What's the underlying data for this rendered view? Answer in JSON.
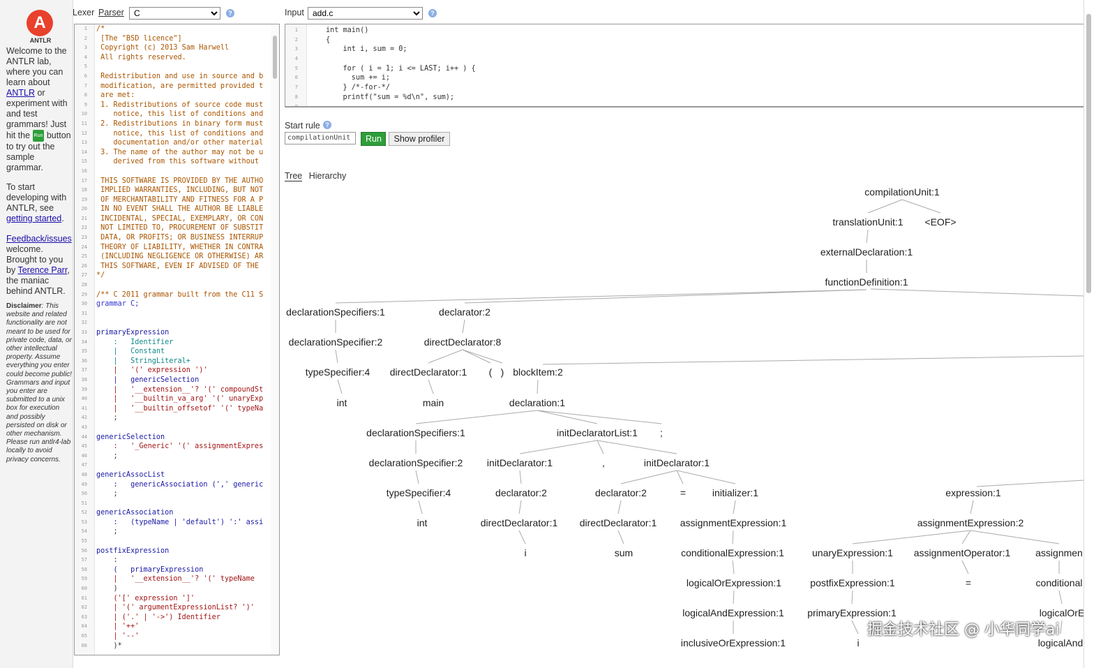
{
  "intro": {
    "logo_text": "ANTLR",
    "p1_a": "Welcome to the ANTLR lab, where you can learn about ",
    "p1_link": "ANTLR",
    "p1_b": " or experiment with and test grammars! Just hit the ",
    "p1_run": "Run",
    "p1_c": " button to try out the sample grammar.",
    "p2_a": "To start developing with ANTLR, see ",
    "p2_link": "getting started",
    "p2_b": ".",
    "p3_link": "Feedback/issues",
    "p3_a": " welcome. Brought to you by ",
    "p3_link2": "Terence Parr",
    "p3_b": ", the maniac behind ANTLR.",
    "disclaimer_label": "Disclaimer",
    "disclaimer_text": ": This website and related functionality are not meant to be used for private code, data, or other intellectual property. Assume everything you enter could become public! Grammars and input you enter are submitted to a unix box for execution and possibly persisted on disk or other mechanism. Please run antlr4-lab locally to avoid privacy concerns."
  },
  "toolbar": {
    "lexer_label": "Lexer",
    "parser_label": "Parser",
    "grammar_select": "C",
    "input_label": "Input",
    "input_select": "add.c",
    "help_glyph": "?"
  },
  "grammar_lines": [
    {
      "n": "1",
      "t": "/*",
      "c": "cm"
    },
    {
      "n": "2",
      "t": " [The \"BSD licence\"]",
      "c": "cm"
    },
    {
      "n": "3",
      "t": " Copyright (c) 2013 Sam Harwell",
      "c": "cm"
    },
    {
      "n": "4",
      "t": " All rights reserved.",
      "c": "cm"
    },
    {
      "n": "5",
      "t": "",
      "c": "cm"
    },
    {
      "n": "6",
      "t": " Redistribution and use in source and b",
      "c": "cm"
    },
    {
      "n": "7",
      "t": " modification, are permitted provided t",
      "c": "cm"
    },
    {
      "n": "8",
      "t": " are met:",
      "c": "cm"
    },
    {
      "n": "9",
      "t": " 1. Redistributions of source code must",
      "c": "cm"
    },
    {
      "n": "10",
      "t": "    notice, this list of conditions and",
      "c": "cm"
    },
    {
      "n": "11",
      "t": " 2. Redistributions in binary form must",
      "c": "cm"
    },
    {
      "n": "12",
      "t": "    notice, this list of conditions and",
      "c": "cm"
    },
    {
      "n": "13",
      "t": "    documentation and/or other material",
      "c": "cm"
    },
    {
      "n": "14",
      "t": " 3. The name of the author may not be u",
      "c": "cm"
    },
    {
      "n": "15",
      "t": "    derived from this software without",
      "c": "cm"
    },
    {
      "n": "16",
      "t": "",
      "c": "cm"
    },
    {
      "n": "17",
      "t": " THIS SOFTWARE IS PROVIDED BY THE AUTHO",
      "c": "cm"
    },
    {
      "n": "18",
      "t": " IMPLIED WARRANTIES, INCLUDING, BUT NOT",
      "c": "cm"
    },
    {
      "n": "19",
      "t": " OF MERCHANTABILITY AND FITNESS FOR A P",
      "c": "cm"
    },
    {
      "n": "20",
      "t": " IN NO EVENT SHALL THE AUTHOR BE LIABLE",
      "c": "cm"
    },
    {
      "n": "21",
      "t": " INCIDENTAL, SPECIAL, EXEMPLARY, OR CON",
      "c": "cm"
    },
    {
      "n": "22",
      "t": " NOT LIMITED TO, PROCUREMENT OF SUBSTIT",
      "c": "cm"
    },
    {
      "n": "23",
      "t": " DATA, OR PROFITS; OR BUSINESS INTERRUP",
      "c": "cm"
    },
    {
      "n": "24",
      "t": " THEORY OF LIABILITY, WHETHER IN CONTRA",
      "c": "cm"
    },
    {
      "n": "25",
      "t": " (INCLUDING NEGLIGENCE OR OTHERWISE) AR",
      "c": "cm"
    },
    {
      "n": "26",
      "t": " THIS SOFTWARE, EVEN IF ADVISED OF THE",
      "c": "cm"
    },
    {
      "n": "27",
      "t": "*/",
      "c": "cm"
    },
    {
      "n": "28",
      "t": "",
      "c": "plain"
    },
    {
      "n": "29",
      "t": "/** C 2011 grammar built from the C11 S",
      "c": "cm"
    },
    {
      "n": "30",
      "t": "grammar C;",
      "c": "kw"
    },
    {
      "n": "31",
      "t": "",
      "c": "plain"
    },
    {
      "n": "32",
      "t": "",
      "c": "plain"
    },
    {
      "n": "33",
      "t": "primaryExpression",
      "c": "rule"
    },
    {
      "n": "34",
      "t": "    :   Identifier",
      "c": "id"
    },
    {
      "n": "35",
      "t": "    |   Constant",
      "c": "id"
    },
    {
      "n": "36",
      "t": "    |   StringLiteral+",
      "c": "id"
    },
    {
      "n": "37",
      "t": "    |   '(' expression ')'",
      "c": "str"
    },
    {
      "n": "38",
      "t": "    |   genericSelection",
      "c": "rule"
    },
    {
      "n": "39",
      "t": "    |   '__extension__'? '(' compoundSt",
      "c": "str"
    },
    {
      "n": "40",
      "t": "    |   '__builtin_va_arg' '(' unaryExp",
      "c": "str"
    },
    {
      "n": "41",
      "t": "    |   '__builtin_offsetof' '(' typeNa",
      "c": "str"
    },
    {
      "n": "42",
      "t": "    ;",
      "c": "plain"
    },
    {
      "n": "43",
      "t": "",
      "c": "plain"
    },
    {
      "n": "44",
      "t": "genericSelection",
      "c": "rule"
    },
    {
      "n": "45",
      "t": "    :   '_Generic' '(' assignmentExpres",
      "c": "str"
    },
    {
      "n": "46",
      "t": "    ;",
      "c": "plain"
    },
    {
      "n": "47",
      "t": "",
      "c": "plain"
    },
    {
      "n": "48",
      "t": "genericAssocList",
      "c": "rule"
    },
    {
      "n": "49",
      "t": "    :   genericAssociation (',' generic",
      "c": "rule"
    },
    {
      "n": "50",
      "t": "    ;",
      "c": "plain"
    },
    {
      "n": "51",
      "t": "",
      "c": "plain"
    },
    {
      "n": "52",
      "t": "genericAssociation",
      "c": "rule"
    },
    {
      "n": "53",
      "t": "    :   (typeName | 'default') ':' assi",
      "c": "rule"
    },
    {
      "n": "54",
      "t": "    ;",
      "c": "plain"
    },
    {
      "n": "55",
      "t": "",
      "c": "plain"
    },
    {
      "n": "56",
      "t": "postfixExpression",
      "c": "rule"
    },
    {
      "n": "57",
      "t": "    :",
      "c": "plain"
    },
    {
      "n": "58",
      "t": "    (   primaryExpression",
      "c": "rule"
    },
    {
      "n": "59",
      "t": "    |   '__extension__'? '(' typeName",
      "c": "str"
    },
    {
      "n": "60",
      "t": "    )",
      "c": "plain"
    },
    {
      "n": "61",
      "t": "    ('[' expression ']'",
      "c": "str"
    },
    {
      "n": "62",
      "t": "    | '(' argumentExpressionList? ')'",
      "c": "str"
    },
    {
      "n": "63",
      "t": "    | ('.' | '->') Identifier",
      "c": "str"
    },
    {
      "n": "64",
      "t": "    | '++'",
      "c": "str"
    },
    {
      "n": "65",
      "t": "    | '--'",
      "c": "str"
    },
    {
      "n": "66",
      "t": "    )*",
      "c": "plain"
    }
  ],
  "input_lines": [
    {
      "n": "1",
      "t": "int main()"
    },
    {
      "n": "2",
      "t": "{"
    },
    {
      "n": "3",
      "t": "    int i, sum = 0;"
    },
    {
      "n": "4",
      "t": ""
    },
    {
      "n": "5",
      "t": "    for ( i = 1; i <= LAST; i++ ) {"
    },
    {
      "n": "6",
      "t": "      sum += i;"
    },
    {
      "n": "7",
      "t": "    } /*-for-*/"
    },
    {
      "n": "8",
      "t": "    printf(\"sum = %d\\n\", sum);"
    },
    {
      "n": "9",
      "t": ""
    }
  ],
  "start_rule": {
    "label": "Start rule",
    "value": "compilationUnit",
    "run_label": "Run",
    "profiler_label": "Show profiler"
  },
  "tabs": {
    "tree": "Tree",
    "hierarchy": "Hierarchy"
  },
  "tree_labels": {
    "compilationUnit": "compilationUnit:1",
    "translationUnit": "translationUnit:1",
    "eof": "<EOF>",
    "externalDeclaration": "externalDeclaration:1",
    "functionDefinition": "functionDefinition:1",
    "declSpecs1": "declarationSpecifiers:1",
    "declarator2a": "declarator:2",
    "declSpec2a": "declarationSpecifier:2",
    "directDecl8": "directDeclarator:8",
    "typeSpec4a": "typeSpecifier:4",
    "directDecl1a": "directDeclarator:1",
    "lparen": "(",
    "rparen": ")",
    "blockItem2": "blockItem:2",
    "int1": "int",
    "main": "main",
    "declaration1": "declaration:1",
    "declSpecs1b": "declarationSpecifiers:1",
    "initDeclList": "initDeclaratorList:1",
    "semi": ";",
    "declSpec2b": "declarationSpecifier:2",
    "initDecl1a": "initDeclarator:1",
    "comma": ",",
    "initDecl1b": "initDeclarator:1",
    "typeSpec4b": "typeSpecifier:4",
    "declarator2b": "declarator:2",
    "declarator2c": "declarator:2",
    "eq1": "=",
    "initializer": "initializer:1",
    "expression1": "expression:1",
    "int2": "int",
    "directDecl1b": "directDeclarator:1",
    "directDecl1c": "directDeclarator:1",
    "assignExpr1": "assignmentExpression:1",
    "assignExpr2": "assignmentExpression:2",
    "i1": "i",
    "sum": "sum",
    "condExpr1": "conditionalExpression:1",
    "unaryExpr1": "unaryExpression:1",
    "assignOp1": "assignmentOperator:1",
    "assignmenCut": "assignmen",
    "logicalOr1": "logicalOrExpression:1",
    "postfixExpr1": "postfixExpression:1",
    "eq2": "=",
    "conditionalCut": "conditional",
    "logicalAnd1": "logicalAndExpression:1",
    "primaryExpr1": "primaryExpression:1",
    "logicalOrCut": "logicalOrE",
    "inclusiveOr1": "inclusiveOrExpression:1",
    "i2": "i",
    "logicalAndCut": "logicalAnd"
  },
  "watermark": "掘金技术社区 @ 小华同学ai"
}
